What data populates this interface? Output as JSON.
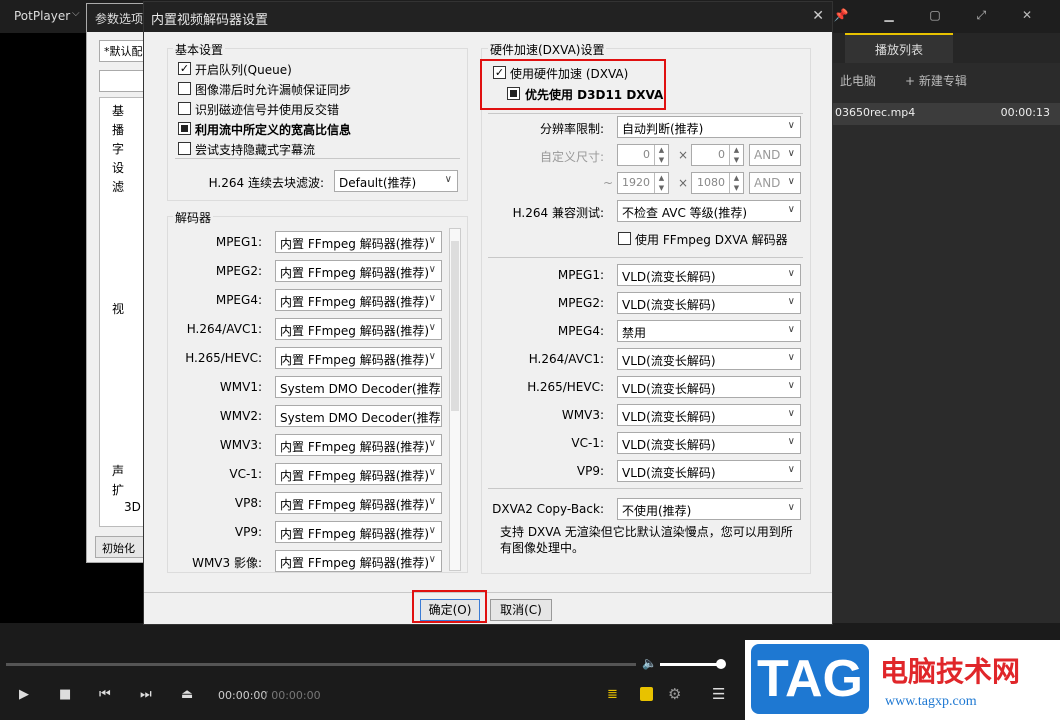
{
  "app": {
    "name": "PotPlayer",
    "menu_arrow": "⌵",
    "window_controls": "📌 ▁ ▢ ⤢ ✕"
  },
  "playlist": {
    "tab": "播放列表",
    "pc": "此电脑",
    "new_album": "+ 新建专辑",
    "file": "03650rec.mp4",
    "duration": "00:00:13"
  },
  "player": {
    "time_current": "00:00:00",
    "time_total": "/ 00:00:00",
    "volume_level": 0.9
  },
  "watermark": {
    "logo": "TAG",
    "title": "电脑技术网",
    "url": "www.tagxp.com"
  },
  "back_dialog": {
    "title": "参数选项",
    "combo": "*默认配",
    "tree": [
      "基",
      "播",
      "字",
      "设",
      "滤",
      "视",
      "声",
      "扩",
      "3D"
    ],
    "reset_button": "初始化"
  },
  "dialog": {
    "title": "内置视频解码器设置",
    "basic": {
      "label": "基本设置",
      "options": [
        {
          "label": "开启队列(Queue)",
          "checked": true,
          "bold": false
        },
        {
          "label": "图像滞后时允许漏帧保证同步",
          "checked": false,
          "bold": false
        },
        {
          "label": "识别磁迹信号并使用反交错",
          "checked": false,
          "bold": false
        },
        {
          "label": "利用流中所定义的宽高比信息",
          "checked": true,
          "bold": true
        },
        {
          "label": "尝试支持隐藏式字幕流",
          "checked": false,
          "bold": false
        }
      ],
      "h264_label": "H.264 连续去块滤波:",
      "h264_value": "Default(推荐)"
    },
    "decoders": {
      "label": "解码器",
      "rows": [
        {
          "name": "MPEG1:",
          "value": "内置 FFmpeg 解码器(推荐)"
        },
        {
          "name": "MPEG2:",
          "value": "内置 FFmpeg 解码器(推荐)"
        },
        {
          "name": "MPEG4:",
          "value": "内置 FFmpeg 解码器(推荐)"
        },
        {
          "name": "H.264/AVC1:",
          "value": "内置 FFmpeg 解码器(推荐)"
        },
        {
          "name": "H.265/HEVC:",
          "value": "内置 FFmpeg 解码器(推荐)"
        },
        {
          "name": "WMV1:",
          "value": "System DMO Decoder(推荐)"
        },
        {
          "name": "WMV2:",
          "value": "System DMO Decoder(推荐)"
        },
        {
          "name": "WMV3:",
          "value": "内置 FFmpeg 解码器(推荐)"
        },
        {
          "name": "VC-1:",
          "value": "内置 FFmpeg 解码器(推荐)"
        },
        {
          "name": "VP8:",
          "value": "内置 FFmpeg 解码器(推荐)"
        },
        {
          "name": "VP9:",
          "value": "内置 FFmpeg 解码器(推荐)"
        },
        {
          "name": "WMV3 影像:",
          "value": "内置 FFmpeg 解码器(推荐)"
        }
      ]
    },
    "hw": {
      "label": "硬件加速(DXVA)设置",
      "use_hw": "使用硬件加速 (DXVA)",
      "use_hw_checked": true,
      "prefer_d3d11": "优先使用 D3D11 DXVA",
      "prefer_checked": "partial",
      "res_limit_label": "分辨率限制:",
      "res_limit_value": "自动判断(推荐)",
      "custom_size_label": "自定义尺寸:",
      "w1": "0",
      "h1": "0",
      "w2": "1920",
      "h2": "1080",
      "and": "AND",
      "tilde": "~",
      "times": "×",
      "h264_compat_label": "H.264 兼容测试:",
      "h264_compat_value": "不检查 AVC 等级(推荐)",
      "ffmpeg_dxva": "使用 FFmpeg DXVA 解码器",
      "ffmpeg_dxva_checked": false,
      "rows": [
        {
          "name": "MPEG1:",
          "value": "VLD(流变长解码)"
        },
        {
          "name": "MPEG2:",
          "value": "VLD(流变长解码)"
        },
        {
          "name": "MPEG4:",
          "value": "禁用"
        },
        {
          "name": "H.264/AVC1:",
          "value": "VLD(流变长解码)"
        },
        {
          "name": "H.265/HEVC:",
          "value": "VLD(流变长解码)"
        },
        {
          "name": "WMV3:",
          "value": "VLD(流变长解码)"
        },
        {
          "name": "VC-1:",
          "value": "VLD(流变长解码)"
        },
        {
          "name": "VP9:",
          "value": "VLD(流变长解码)"
        }
      ],
      "copyback_label": "DXVA2 Copy-Back:",
      "copyback_value": "不使用(推荐)",
      "note": "支持 DXVA 无渲染但它比默认渲染慢点，您可以用到所有图像处理中。"
    },
    "ok": "确定(O)",
    "cancel": "取消(C)"
  }
}
